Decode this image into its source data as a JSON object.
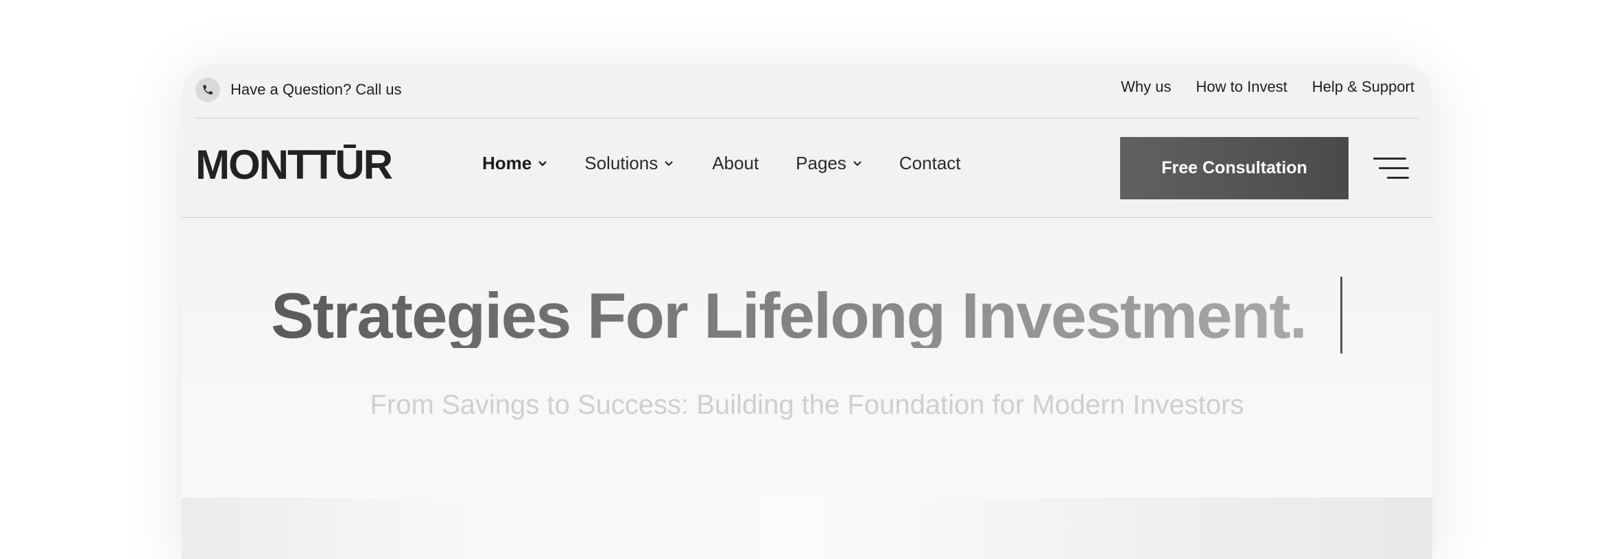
{
  "topbar": {
    "phone_text": "Have a Question? Call us",
    "links": [
      "Why us",
      "How to Invest",
      "Help & Support"
    ]
  },
  "brand": {
    "logo_text": "MONTTŪR"
  },
  "nav": {
    "items": [
      {
        "label": "Home",
        "has_dropdown": true,
        "active": true
      },
      {
        "label": "Solutions",
        "has_dropdown": true,
        "active": false
      },
      {
        "label": "About",
        "has_dropdown": false,
        "active": false
      },
      {
        "label": "Pages",
        "has_dropdown": true,
        "active": false
      },
      {
        "label": "Contact",
        "has_dropdown": false,
        "active": false
      }
    ],
    "cta_label": "Free Consultation"
  },
  "hero": {
    "title": "Strategies For Lifelong Investment.",
    "subtitle": "From Savings to Success: Building the Foundation for Modern Investors"
  },
  "icons": {
    "phone": "phone-icon",
    "chevron": "chevron-down-icon",
    "menu": "hamburger-menu-icon"
  },
  "colors": {
    "cta_bg": "#555555",
    "card_bg": "#f2f2f2",
    "text_dark": "#1e1e1e",
    "subtitle": "#cfcfcf"
  }
}
